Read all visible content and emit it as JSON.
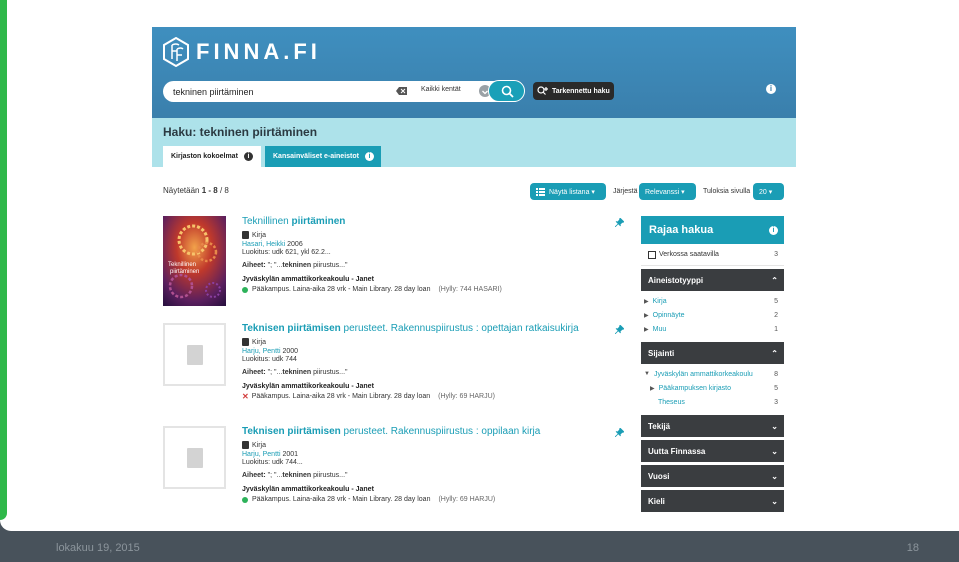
{
  "slide": {
    "footer_date": "lokakuu 19, 2015",
    "page_number": "18",
    "accent_color": "#2fb84a",
    "footer_color": "#48525b"
  },
  "header": {
    "logo_text": "FINNA.FI",
    "search": {
      "value": "tekninen piirtäminen",
      "field_select": "Kaikki kentät"
    },
    "advanced_label": "Tarkennettu haku",
    "info_icon": "i"
  },
  "subheader": {
    "title": "Haku: tekninen piirtäminen",
    "tabs": [
      {
        "label": "Kirjaston kokoelmat",
        "active": true
      },
      {
        "label": "Kansainväliset e-aineistot",
        "active": false
      }
    ]
  },
  "toolbar": {
    "results_prefix": "Näytetään ",
    "results_range": "1 - 8",
    "results_suffix": " / 8",
    "view_label": "Näytä listana ▾",
    "sort_label": "Järjestä",
    "sort_value": "Relevanssi ▾",
    "per_page_label": "Tuloksia sivulla",
    "per_page_value": "20 ▾"
  },
  "records": [
    {
      "title_a": "Teknillinen ",
      "title_b": "piirtäminen",
      "title_c": "",
      "format": "Kirja",
      "author": "Hasari, Heikki",
      "year": "2006",
      "classification": "Luokitus: udk 621, ykl 62.2...",
      "subjects_label": "Aiheet: ",
      "subjects_pre": "\"; \"...",
      "subjects_bold": "tekninen",
      "subjects_post": " piirustus...\"",
      "organisation": "Jyväskylän ammattikorkeakoulu - Janet",
      "location": "Pääkampus. Laina-aika 28 vrk - Main Library. 28 day loan",
      "shelf": "(Hylly: 744 HASARI)",
      "available": true,
      "cover_title": "Teknillinen piirtäminen"
    },
    {
      "title_a": "Teknisen ",
      "title_b": "piirtämisen",
      "title_c": " perusteet. Rakennuspiirustus : opettajan ratkaisukirja",
      "format": "Kirja",
      "author": "Harju, Pentti",
      "year": "2000",
      "classification": "Luokitus: udk 744",
      "subjects_label": "Aiheet: ",
      "subjects_pre": "\"; \"...",
      "subjects_bold": "tekninen",
      "subjects_post": " piirustus...\"",
      "organisation": "Jyväskylän ammattikorkeakoulu - Janet",
      "location": "Pääkampus. Laina-aika 28 vrk - Main Library. 28 day loan",
      "shelf": "(Hylly: 69 HARJU)",
      "available": false
    },
    {
      "title_a": "Teknisen ",
      "title_b": "piirtämisen",
      "title_c": " perusteet. Rakennuspiirustus : oppilaan kirja",
      "format": "Kirja",
      "author": "Harju, Pentti",
      "year": "2001",
      "classification": "Luokitus: udk 744...",
      "subjects_label": "Aiheet: ",
      "subjects_pre": "\"; \"...",
      "subjects_bold": "tekninen",
      "subjects_post": " piirustus...\"",
      "organisation": "Jyväskylän ammattikorkeakoulu - Janet",
      "location": "Pääkampus. Laina-aika 28 vrk - Main Library. 28 day loan",
      "shelf": "(Hylly: 69 HARJU)",
      "available": true
    }
  ],
  "sidebar": {
    "title": "Rajaa hakua",
    "online_label": "Verkossa saatavilla",
    "online_count": "3",
    "facets": [
      {
        "label": "Aineistotyyppi",
        "open": true,
        "items": [
          {
            "label": "Kirja",
            "count": "5",
            "indent": 0,
            "marker": "▶"
          },
          {
            "label": "Opinnäyte",
            "count": "2",
            "indent": 0,
            "marker": "▶"
          },
          {
            "label": "Muu",
            "count": "1",
            "indent": 0,
            "marker": "▶"
          }
        ]
      },
      {
        "label": "Sijainti",
        "open": true,
        "items": [
          {
            "label": "Jyväskylän ammattikorkeakoulu",
            "count": "8",
            "indent": 0,
            "marker": "▼"
          },
          {
            "label": "Pääkampuksen kirjasto",
            "count": "5",
            "indent": 1,
            "marker": "▶"
          },
          {
            "label": "Theseus",
            "count": "3",
            "indent": 1,
            "marker": ""
          }
        ]
      },
      {
        "label": "Tekijä",
        "open": false,
        "items": []
      },
      {
        "label": "Uutta Finnassa",
        "open": false,
        "items": []
      },
      {
        "label": "Vuosi",
        "open": false,
        "items": []
      },
      {
        "label": "Kieli",
        "open": false,
        "items": []
      }
    ]
  }
}
